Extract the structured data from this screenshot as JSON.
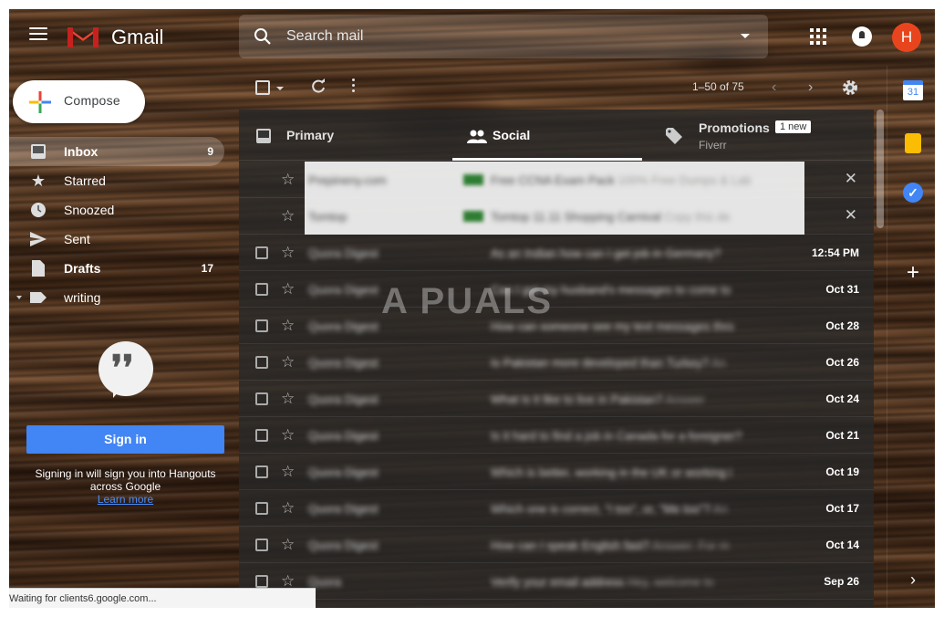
{
  "app": {
    "brand": "Gmail",
    "avatar_letter": "H"
  },
  "search": {
    "placeholder": "Search mail"
  },
  "sidebar": {
    "compose_label": "Compose",
    "items": [
      {
        "label": "Inbox",
        "count": "9",
        "icon": "inbox-icon"
      },
      {
        "label": "Starred",
        "count": "",
        "icon": "star-icon"
      },
      {
        "label": "Snoozed",
        "count": "",
        "icon": "clock-icon"
      },
      {
        "label": "Sent",
        "count": "",
        "icon": "send-icon"
      },
      {
        "label": "Drafts",
        "count": "17",
        "icon": "draft-icon"
      },
      {
        "label": "writing",
        "count": "",
        "icon": "label-icon"
      }
    ]
  },
  "hangouts": {
    "signin_label": "Sign in",
    "text": "Signing in will sign you into Hangouts across Google",
    "learn_more": "Learn more"
  },
  "toolbar": {
    "pager": "1–50 of 75"
  },
  "tabs": {
    "primary": "Primary",
    "social": "Social",
    "promotions": "Promotions",
    "promotions_badge": "1 new",
    "promotions_sub": "Fiverr"
  },
  "emails": [
    {
      "sender": "Prepineny.com",
      "subject": "Free CCNA Exam Pack",
      "snippet": "100% Free Dumps & Lab",
      "date": "",
      "style": "light"
    },
    {
      "sender": "Tomtop",
      "subject": "Tomtop 11.11 Shopping Carnival",
      "snippet": "Copy this de",
      "date": "",
      "style": "light"
    },
    {
      "sender": "Quora Digest",
      "subject": "As an Indian how can I get job in Germany?",
      "snippet": "",
      "date": "12:54 PM",
      "style": "dark"
    },
    {
      "sender": "Quora Digest",
      "subject": "Can I get my husband's messages to come to",
      "snippet": "",
      "date": "Oct 31",
      "style": "dark"
    },
    {
      "sender": "Quora Digest",
      "subject": "How can someone see my text messages thro",
      "snippet": "",
      "date": "Oct 28",
      "style": "dark"
    },
    {
      "sender": "Quora Digest",
      "subject": "Is Pakistan more developed than Turkey?",
      "snippet": "An",
      "date": "Oct 26",
      "style": "dark"
    },
    {
      "sender": "Quora Digest",
      "subject": "What is it like to live in Pakistan?",
      "snippet": "Answer",
      "date": "Oct 24",
      "style": "dark"
    },
    {
      "sender": "Quora Digest",
      "subject": "Is it hard to find a job in Canada for a foreigner?",
      "snippet": "",
      "date": "Oct 21",
      "style": "dark"
    },
    {
      "sender": "Quora Digest",
      "subject": "Which is better, working in the UK or working i",
      "snippet": "",
      "date": "Oct 19",
      "style": "dark"
    },
    {
      "sender": "Quora Digest",
      "subject": "Which one is correct, \"I too\", or, \"Me too\"?",
      "snippet": "An",
      "date": "Oct 17",
      "style": "dark"
    },
    {
      "sender": "Quora Digest",
      "subject": "How can I speak English fast?",
      "snippet": "Answer: For m",
      "date": "Oct 14",
      "style": "dark"
    },
    {
      "sender": "Quora",
      "subject": "Verify your email address",
      "snippet": "Hey, welcome to",
      "date": "Sep 26",
      "style": "dark"
    }
  ],
  "watermark": "A PUALS",
  "status_bar": "Waiting for clients6.google.com...",
  "right_panel": {
    "calendar_day": "31"
  },
  "colors": {
    "accent": "#4285f4",
    "avatar": "#e8451e",
    "gmail_red": "#d93025"
  }
}
